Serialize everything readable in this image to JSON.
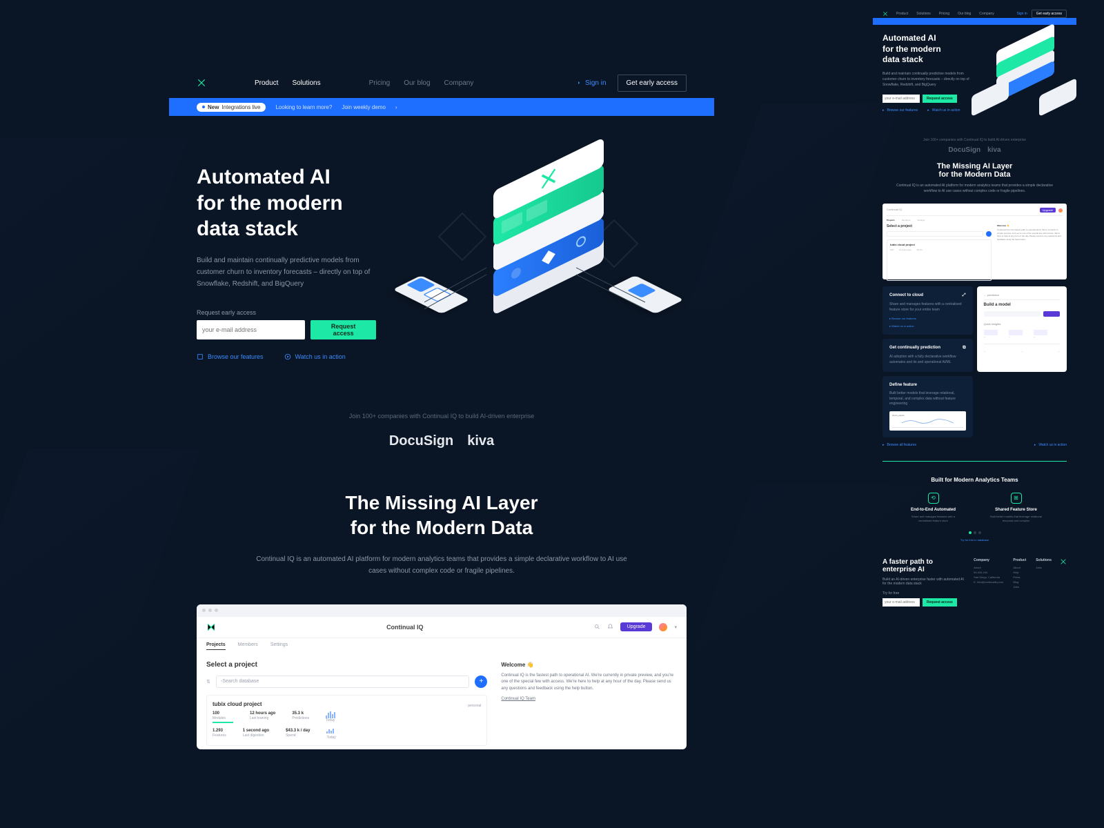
{
  "nav": {
    "links": [
      "Product",
      "Solutions"
    ],
    "links_muted": [
      "Pricing",
      "Our blog",
      "Company"
    ],
    "signin": "Sign in",
    "cta": "Get early access"
  },
  "banner": {
    "pill_tag": "New",
    "pill_text": "Integrations live",
    "text": "Looking to learn more?",
    "link": "Join weekly demo"
  },
  "hero": {
    "title_l1": "Automated AI",
    "title_l2": "for the modern",
    "title_l3": "data stack",
    "sub": "Build and maintain continually predictive models from customer churn to inventory forecasts – directly on top of Snowflake, Redshift, and BigQuery",
    "form_label": "Request early access",
    "placeholder": "your e-mail address",
    "button": "Request access",
    "link1": "Browse our features",
    "link2": "Watch us in action"
  },
  "social": {
    "text": "Join 100+ companies with Continual IQ to build AI-driven enterprise",
    "logo1": "DocuSign",
    "logo2": "kiva"
  },
  "section2": {
    "title_l1": "The Missing AI Layer",
    "title_l2": "for the Modern Data",
    "sub": "Continual IQ is an automated AI platform for modern analytics teams that provides a simple declarative workflow to AI use cases without complex code or fragile pipelines."
  },
  "mock": {
    "brand": "Continual IQ",
    "upgrade": "Upgrade",
    "tabs": [
      "Projects",
      "Members",
      "Settings"
    ],
    "select_title": "Select a project",
    "search_ph": "Search database",
    "proj_name": "tubix cloud project",
    "proj_badge": "personal",
    "stats": [
      {
        "val": "100",
        "label": "Modules",
        "bar": true
      },
      {
        "val": "12 hours ago",
        "label": "Last training"
      },
      {
        "val": "35.3 k",
        "label": "Predictions"
      }
    ],
    "stats2": [
      {
        "val": "1.293",
        "label": "Features"
      },
      {
        "val": "1 second ago",
        "label": "Last digestion"
      },
      {
        "val": "$43.3 k / day",
        "label": "Spend"
      }
    ],
    "spark_label": "Today",
    "welcome_title": "Welcome 👋",
    "welcome_body": "Continual IQ is the fastest path to operational AI. We're currently in private preview, and you're one of the special few with access. We're here to help at any hour of the day. Please send us any questions and feedback using the help button.",
    "welcome_team": "Continual IQ Team"
  },
  "cards": {
    "c1": {
      "title": "Connect to cloud",
      "body": "Share and manages features with a centralised feature store for your entire team"
    },
    "c2": {
      "title": "Get continually prediction",
      "body": "AI adoption with a fully declarative workflow automates and its and operational AI/ML"
    },
    "c3": {
      "title": "Define feature",
      "body": "Built better models that leverage relational, temporal, and complex data without feature engineering"
    },
    "card_chart_label": "churn_export",
    "link1": "Browse all features",
    "link2": "Watch us in action"
  },
  "light_card": {
    "title": "prediction",
    "item1": "Build a model",
    "item2": "Quick insights"
  },
  "features": {
    "heading": "Built for Modern Analytics Teams",
    "f1": {
      "title": "End-to-End Automated",
      "desc": "Share and manages features with a centralised feature store"
    },
    "f2": {
      "title": "Shared Feature Store",
      "desc": "Built better models that leverage relational temporal and complex"
    },
    "link": "Try for free in database"
  },
  "footer": {
    "title_l1": "A faster path to",
    "title_l2": "enterprise AI",
    "sub": "Build an AI-driven enterprise faster with automated AI for the modern data stack",
    "try_label": "Try for free",
    "col_company": {
      "h": "Company",
      "items": [
        "About",
        "54.434.434",
        "San Diego, California",
        "E: info@continualiq.com"
      ]
    },
    "col_product": {
      "h": "Product",
      "items": [
        "About",
        "Help",
        "Press",
        "Blog",
        "Jobs"
      ]
    },
    "col_solutions": {
      "h": "Solutions",
      "items": [
        "Jobs"
      ]
    }
  },
  "colors": {
    "accent": "#1ee8a5",
    "blue": "#1e6fff"
  }
}
